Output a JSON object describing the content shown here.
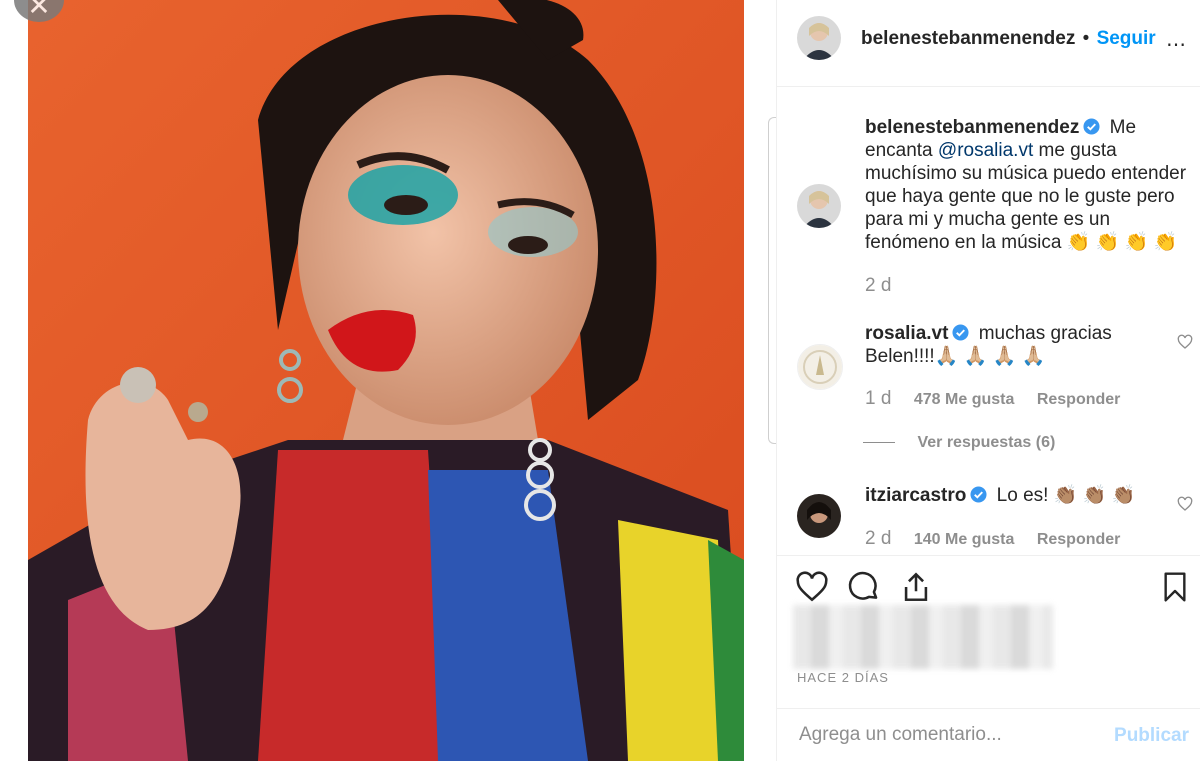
{
  "header": {
    "username": "belenestebanmenendez",
    "separator": "•",
    "follow_label": "Seguir",
    "more_icon": "ellipsis-icon"
  },
  "caption": {
    "username": "belenestebanmenendez",
    "text_before": " Me encanta ",
    "mention": "@rosalia.vt",
    "text_after": " me gusta muchísimo su música puedo entender que haya gente que no le guste pero para mi y mucha gente es un fenómeno en la música 👏 👏 👏 👏",
    "time": "2 d"
  },
  "comments": [
    {
      "username": "rosalia.vt",
      "text": " muchas gracias Belen!!!!🙏🏼 🙏🏼 🙏🏼 🙏🏼",
      "time": "1 d",
      "likes": "478 Me gusta",
      "reply": "Responder",
      "view_replies": "Ver respuestas (6)"
    },
    {
      "username": "itziarcastro",
      "text": " Lo es! 👏🏽 👏🏽 👏🏽",
      "time": "2 d",
      "likes": "140 Me gusta",
      "reply": "Responder"
    }
  ],
  "actions": {
    "like_icon": "heart-icon",
    "comment_icon": "comment-icon",
    "share_icon": "share-icon",
    "save_icon": "bookmark-icon"
  },
  "post_time": "HACE 2 DÍAS",
  "add_comment": {
    "placeholder": "Agrega un comentario...",
    "publish_label": "Publicar"
  },
  "colors": {
    "link": "#0095f6",
    "mention": "#00376b",
    "publish_disabled": "#b3dbff",
    "verified": "#3897f0"
  }
}
